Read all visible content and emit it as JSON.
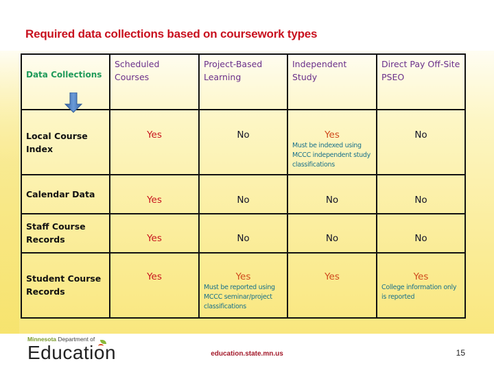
{
  "slide": {
    "title": "Required data collections based on coursework types",
    "page_number": "15",
    "footer_url": "education.state.mn.us"
  },
  "logo": {
    "state": "Minnesota",
    "dept": "Department of",
    "name_prefix": "Educati",
    "name_suffix": "n",
    "icon": "apple-o-icon"
  },
  "table": {
    "corner_header": "Data Collections",
    "corner_icon": "arrow-down-icon",
    "columns": [
      "Scheduled Courses",
      "Project-Based Learning",
      "Independent Study",
      "Direct Pay Off-Site PSEO"
    ],
    "rows": [
      {
        "label": "Local Course Index",
        "cells": [
          {
            "value": "Yes",
            "note": ""
          },
          {
            "value": "No",
            "note": ""
          },
          {
            "value": "Yes",
            "note": "Must be indexed using MCCC independent study classifications"
          },
          {
            "value": "No",
            "note": ""
          }
        ]
      },
      {
        "label": "Calendar Data",
        "cells": [
          {
            "value": "Yes",
            "note": ""
          },
          {
            "value": "No",
            "note": ""
          },
          {
            "value": "No",
            "note": ""
          },
          {
            "value": "No",
            "note": ""
          }
        ]
      },
      {
        "label": "Staff Course Records",
        "cells": [
          {
            "value": "Yes",
            "note": ""
          },
          {
            "value": "No",
            "note": ""
          },
          {
            "value": "No",
            "note": ""
          },
          {
            "value": "No",
            "note": ""
          }
        ]
      },
      {
        "label": "Student Course Records",
        "cells": [
          {
            "value": "Yes",
            "note": ""
          },
          {
            "value": "Yes",
            "note": "Must be reported using MCCC seminar/project classifications"
          },
          {
            "value": "Yes",
            "note": ""
          },
          {
            "value": "Yes",
            "note": "College information only is reported"
          }
        ]
      }
    ]
  },
  "colors": {
    "title": "#c8101e",
    "corner_header": "#1f9a5a",
    "column_header": "#6a2f8a",
    "yes_scheduled": "#c8141e",
    "yes": "#cf4a1c",
    "no": "#141428",
    "note": "#17708a",
    "arrow": "#4a78b8",
    "footer_url": "#a3192a"
  }
}
